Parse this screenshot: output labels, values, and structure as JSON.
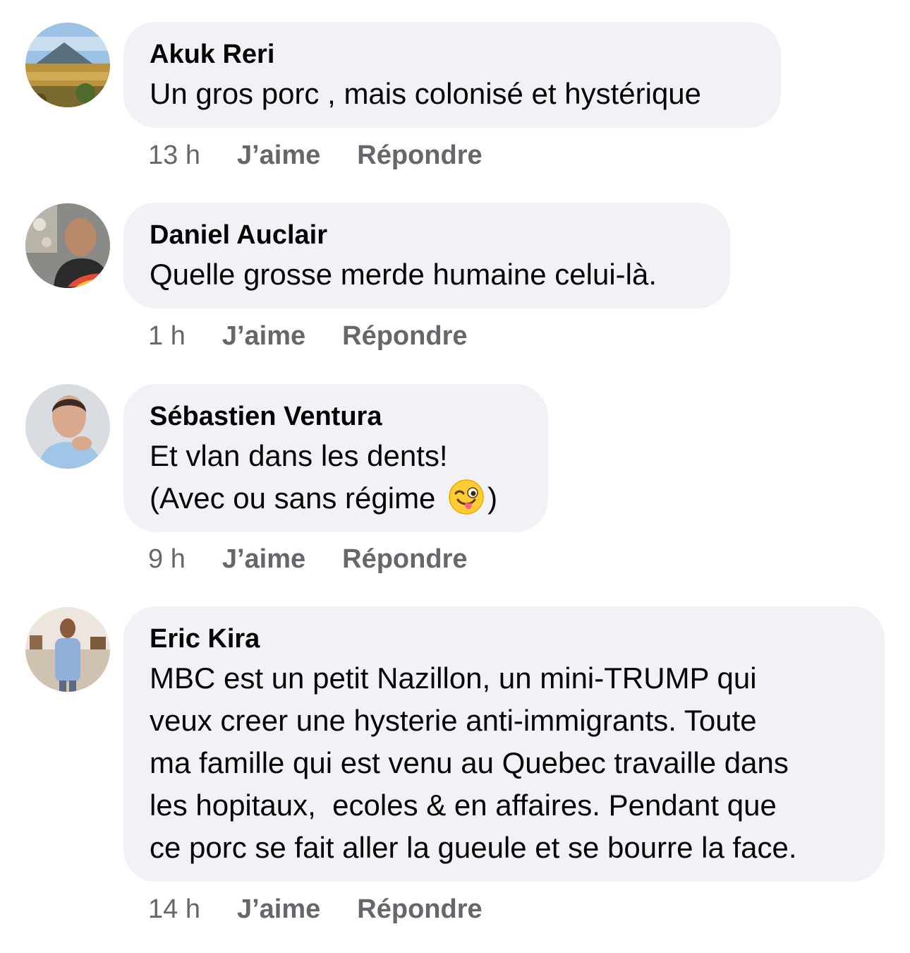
{
  "comments": [
    {
      "author": "Akuk Reri",
      "text": "Un gros porc , mais colonisé et hystérique",
      "time": "13 h",
      "like_label": "J’aime",
      "reply_label": "Répondre"
    },
    {
      "author": "Daniel Auclair",
      "text": "Quelle grosse merde humaine celui-là.",
      "time": "1 h",
      "like_label": "J’aime",
      "reply_label": "Répondre"
    },
    {
      "author": "Sébastien Ventura",
      "text_line1": "Et vlan dans les dents!",
      "text_line2_before": "(Avec ou sans régime ",
      "text_line2_after": ")",
      "emoji": "winking-face-with-tongue-icon",
      "time": "9 h",
      "like_label": "J’aime",
      "reply_label": "Répondre"
    },
    {
      "author": "Eric Kira",
      "text": "MBC est un petit Nazillon, un mini-TRUMP qui\nveux creer une hysterie anti-immigrants. Toute\nma famille qui est venu au Quebec travaille dans\nles hopitaux,  ecoles & en affaires. Pendant que\nce porc se fait aller la gueule et se bourre la face.",
      "time": "14 h",
      "like_label": "J’aime",
      "reply_label": "Répondre"
    }
  ],
  "colors": {
    "bubble": "#f0f2f5",
    "meta_text": "#65676b",
    "body_text": "#050505"
  }
}
